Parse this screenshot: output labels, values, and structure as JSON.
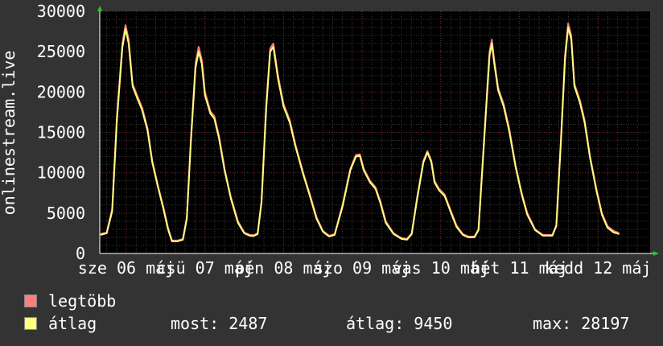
{
  "chart_data": {
    "type": "line",
    "ylabel": "onlinestream.live",
    "ylim": [
      0,
      30000
    ],
    "y_ticks": [
      0,
      5000,
      10000,
      15000,
      20000,
      25000,
      30000
    ],
    "x_tick_labels": [
      "sze 06 máj",
      "csü 07 máj",
      "pén 08 máj",
      "szo 09 máj",
      "vas 10 máj",
      "hét 11 máj",
      "kedd 12 máj"
    ],
    "grid": true,
    "x_days": [
      0,
      7
    ],
    "series": [
      {
        "name": "legtöbb",
        "color": "#ff7f7f",
        "points": [
          [
            -0.33,
            2400
          ],
          [
            -0.25,
            2600
          ],
          [
            -0.18,
            5500
          ],
          [
            -0.12,
            17000
          ],
          [
            -0.05,
            26000
          ],
          [
            -0.01,
            28300
          ],
          [
            0.03,
            26500
          ],
          [
            0.08,
            21000
          ],
          [
            0.14,
            19500
          ],
          [
            0.2,
            18100
          ],
          [
            0.27,
            15500
          ],
          [
            0.33,
            11500
          ],
          [
            0.4,
            8500
          ],
          [
            0.47,
            5800
          ],
          [
            0.53,
            3200
          ],
          [
            0.58,
            1600
          ],
          [
            0.65,
            1600
          ],
          [
            0.72,
            1800
          ],
          [
            0.77,
            4500
          ],
          [
            0.82,
            14000
          ],
          [
            0.88,
            23500
          ],
          [
            0.92,
            25600
          ],
          [
            0.96,
            24000
          ],
          [
            1.0,
            20000
          ],
          [
            1.07,
            17600
          ],
          [
            1.12,
            17000
          ],
          [
            1.18,
            14500
          ],
          [
            1.25,
            10500
          ],
          [
            1.33,
            7000
          ],
          [
            1.42,
            4000
          ],
          [
            1.5,
            2600
          ],
          [
            1.57,
            2300
          ],
          [
            1.62,
            2250
          ],
          [
            1.67,
            2500
          ],
          [
            1.72,
            6500
          ],
          [
            1.78,
            18500
          ],
          [
            1.83,
            25400
          ],
          [
            1.87,
            26000
          ],
          [
            1.93,
            22000
          ],
          [
            2.0,
            18500
          ],
          [
            2.08,
            16500
          ],
          [
            2.15,
            13500
          ],
          [
            2.25,
            10000
          ],
          [
            2.33,
            7500
          ],
          [
            2.42,
            4500
          ],
          [
            2.5,
            2800
          ],
          [
            2.58,
            2200
          ],
          [
            2.65,
            2400
          ],
          [
            2.75,
            6000
          ],
          [
            2.85,
            10500
          ],
          [
            2.92,
            12200
          ],
          [
            2.97,
            12300
          ],
          [
            3.02,
            10500
          ],
          [
            3.1,
            9000
          ],
          [
            3.17,
            8200
          ],
          [
            3.23,
            6500
          ],
          [
            3.3,
            4000
          ],
          [
            3.4,
            2500
          ],
          [
            3.5,
            1900
          ],
          [
            3.57,
            1800
          ],
          [
            3.63,
            2500
          ],
          [
            3.7,
            7000
          ],
          [
            3.78,
            11500
          ],
          [
            3.83,
            12700
          ],
          [
            3.88,
            11500
          ],
          [
            3.92,
            9000
          ],
          [
            3.98,
            8000
          ],
          [
            4.05,
            7300
          ],
          [
            4.12,
            5500
          ],
          [
            4.2,
            3500
          ],
          [
            4.28,
            2400
          ],
          [
            4.35,
            2100
          ],
          [
            4.43,
            2100
          ],
          [
            4.48,
            3000
          ],
          [
            4.55,
            14000
          ],
          [
            4.62,
            25000
          ],
          [
            4.65,
            26500
          ],
          [
            4.68,
            24000
          ],
          [
            4.73,
            20500
          ],
          [
            4.8,
            18500
          ],
          [
            4.87,
            15500
          ],
          [
            4.95,
            11000
          ],
          [
            5.03,
            7500
          ],
          [
            5.1,
            5000
          ],
          [
            5.2,
            3000
          ],
          [
            5.3,
            2300
          ],
          [
            5.42,
            2300
          ],
          [
            5.47,
            3500
          ],
          [
            5.53,
            14500
          ],
          [
            5.58,
            24500
          ],
          [
            5.62,
            28500
          ],
          [
            5.66,
            27000
          ],
          [
            5.7,
            21000
          ],
          [
            5.77,
            19000
          ],
          [
            5.83,
            16500
          ],
          [
            5.9,
            12000
          ],
          [
            5.98,
            8000
          ],
          [
            6.05,
            5000
          ],
          [
            6.12,
            3400
          ],
          [
            6.2,
            2800
          ],
          [
            6.27,
            2500
          ]
        ]
      },
      {
        "name": "átlag",
        "color": "#ffff80",
        "points": [
          [
            -0.33,
            2300
          ],
          [
            -0.25,
            2500
          ],
          [
            -0.18,
            5200
          ],
          [
            -0.12,
            16500
          ],
          [
            -0.05,
            25500
          ],
          [
            -0.01,
            27800
          ],
          [
            0.03,
            26000
          ],
          [
            0.08,
            20700
          ],
          [
            0.14,
            19200
          ],
          [
            0.2,
            17800
          ],
          [
            0.27,
            15200
          ],
          [
            0.33,
            11300
          ],
          [
            0.4,
            8300
          ],
          [
            0.47,
            5600
          ],
          [
            0.53,
            3000
          ],
          [
            0.58,
            1500
          ],
          [
            0.65,
            1500
          ],
          [
            0.72,
            1700
          ],
          [
            0.77,
            4300
          ],
          [
            0.82,
            13600
          ],
          [
            0.88,
            23000
          ],
          [
            0.92,
            25000
          ],
          [
            0.96,
            23500
          ],
          [
            1.0,
            19600
          ],
          [
            1.07,
            17300
          ],
          [
            1.12,
            16700
          ],
          [
            1.18,
            14200
          ],
          [
            1.25,
            10300
          ],
          [
            1.33,
            6800
          ],
          [
            1.42,
            3800
          ],
          [
            1.5,
            2500
          ],
          [
            1.57,
            2200
          ],
          [
            1.62,
            2150
          ],
          [
            1.67,
            2400
          ],
          [
            1.72,
            6300
          ],
          [
            1.78,
            18000
          ],
          [
            1.83,
            25000
          ],
          [
            1.87,
            25600
          ],
          [
            1.93,
            21600
          ],
          [
            2.0,
            18200
          ],
          [
            2.08,
            16200
          ],
          [
            2.15,
            13300
          ],
          [
            2.25,
            9800
          ],
          [
            2.33,
            7300
          ],
          [
            2.42,
            4300
          ],
          [
            2.5,
            2700
          ],
          [
            2.58,
            2100
          ],
          [
            2.65,
            2300
          ],
          [
            2.75,
            5800
          ],
          [
            2.85,
            10300
          ],
          [
            2.92,
            12000
          ],
          [
            2.97,
            12100
          ],
          [
            3.02,
            10300
          ],
          [
            3.1,
            8800
          ],
          [
            3.17,
            8000
          ],
          [
            3.23,
            6300
          ],
          [
            3.3,
            3800
          ],
          [
            3.4,
            2400
          ],
          [
            3.5,
            1800
          ],
          [
            3.57,
            1700
          ],
          [
            3.63,
            2400
          ],
          [
            3.7,
            6800
          ],
          [
            3.78,
            11300
          ],
          [
            3.83,
            12500
          ],
          [
            3.88,
            11300
          ],
          [
            3.92,
            8800
          ],
          [
            3.98,
            7800
          ],
          [
            4.05,
            7100
          ],
          [
            4.12,
            5300
          ],
          [
            4.2,
            3300
          ],
          [
            4.28,
            2300
          ],
          [
            4.35,
            2000
          ],
          [
            4.43,
            2000
          ],
          [
            4.48,
            2900
          ],
          [
            4.55,
            13600
          ],
          [
            4.62,
            24500
          ],
          [
            4.65,
            26000
          ],
          [
            4.68,
            23600
          ],
          [
            4.73,
            20200
          ],
          [
            4.8,
            18200
          ],
          [
            4.87,
            15200
          ],
          [
            4.95,
            10800
          ],
          [
            5.03,
            7300
          ],
          [
            5.1,
            4800
          ],
          [
            5.2,
            2900
          ],
          [
            5.3,
            2200
          ],
          [
            5.42,
            2200
          ],
          [
            5.47,
            3400
          ],
          [
            5.53,
            14100
          ],
          [
            5.58,
            24000
          ],
          [
            5.62,
            28000
          ],
          [
            5.66,
            26500
          ],
          [
            5.7,
            20700
          ],
          [
            5.77,
            18700
          ],
          [
            5.83,
            16200
          ],
          [
            5.9,
            11800
          ],
          [
            5.98,
            7800
          ],
          [
            6.05,
            4800
          ],
          [
            6.12,
            3200
          ],
          [
            6.2,
            2600
          ],
          [
            6.27,
            2400
          ]
        ]
      }
    ]
  },
  "legend": [
    {
      "label": "legtöbb",
      "color": "#ff7f7f"
    },
    {
      "label": "átlag",
      "color": "#ffff80"
    }
  ],
  "stats": {
    "current": "most: 2487",
    "average": "átlag: 9450",
    "max": "max: 28197"
  }
}
